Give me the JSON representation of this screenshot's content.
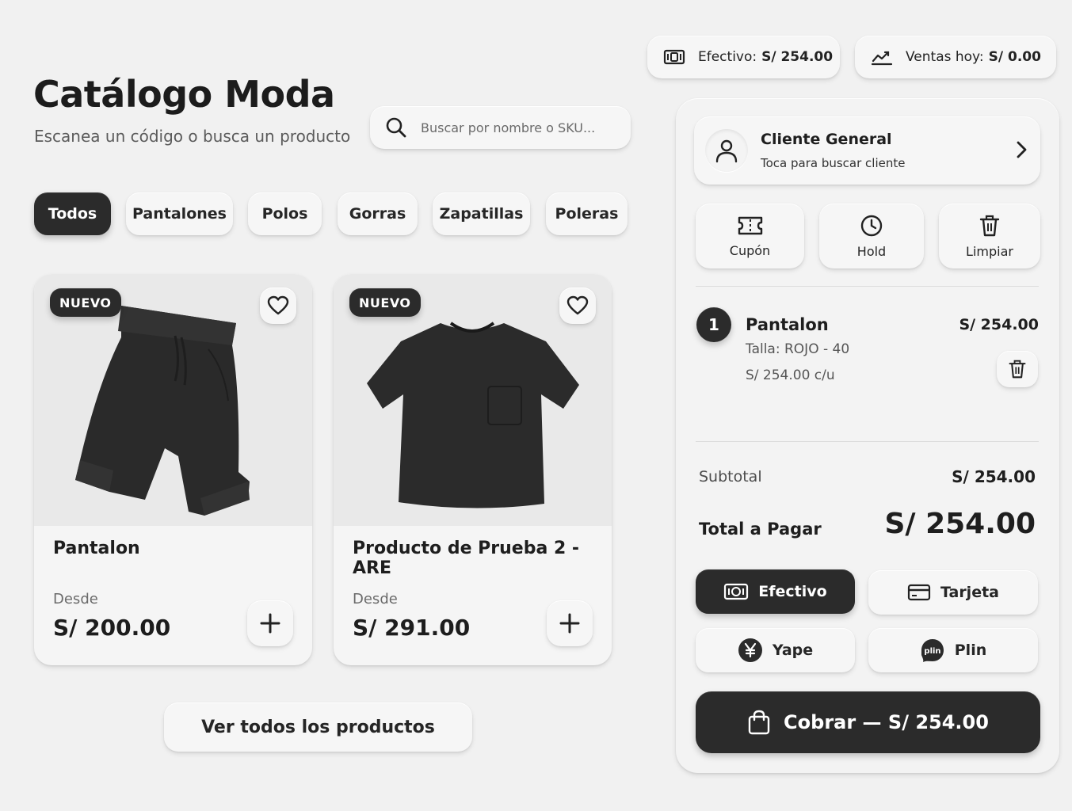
{
  "stats": {
    "cash_label": "Efectivo:",
    "cash_value": "S/ 254.00",
    "sales_label": "Ventas hoy:",
    "sales_value": "S/ 0.00"
  },
  "header": {
    "title": "Catálogo Moda",
    "subtitle": "Escanea un código o busca un producto"
  },
  "search": {
    "placeholder": "Buscar por nombre o SKU..."
  },
  "categories": [
    {
      "label": "Todos",
      "active": true
    },
    {
      "label": "Pantalones",
      "active": false
    },
    {
      "label": "Polos",
      "active": false
    },
    {
      "label": "Gorras",
      "active": false
    },
    {
      "label": "Zapatillas",
      "active": false
    },
    {
      "label": "Poleras",
      "active": false
    }
  ],
  "products": [
    {
      "badge": "NUEVO",
      "name": "Pantalon",
      "from_label": "Desde",
      "price": "S/ 200.00",
      "image": "black-shorts"
    },
    {
      "badge": "NUEVO",
      "name": "Producto de Prueba 2 - ARE",
      "from_label": "Desde",
      "price": "S/ 291.00",
      "image": "black-tshirt"
    }
  ],
  "view_all_label": "Ver todos los productos",
  "client": {
    "name": "Cliente General",
    "hint": "Toca para buscar cliente"
  },
  "actions": [
    {
      "label": "Cupón",
      "icon": "coupon-icon"
    },
    {
      "label": "Hold",
      "icon": "clock-icon"
    },
    {
      "label": "Limpiar",
      "icon": "trash-icon"
    }
  ],
  "cart": {
    "items": [
      {
        "qty": "1",
        "name": "Pantalon",
        "variant": "Talla: ROJO - 40",
        "unit_price": "S/ 254.00 c/u",
        "total": "S/ 254.00"
      }
    ],
    "subtotal_label": "Subtotal",
    "subtotal_value": "S/ 254.00",
    "total_label": "Total a Pagar",
    "total_value": "S/ 254.00"
  },
  "payment_methods": [
    {
      "label": "Efectivo",
      "icon": "cash-icon",
      "active": true
    },
    {
      "label": "Tarjeta",
      "icon": "card-icon",
      "active": false
    },
    {
      "label": "Yape",
      "icon": "yape-icon",
      "active": false
    },
    {
      "label": "Plin",
      "icon": "plin-icon",
      "active": false
    }
  ],
  "checkout_label": "Cobrar — S/ 254.00",
  "colors": {
    "background": "#f1f1f1",
    "dark": "#2b2b2b",
    "surface": "#f6f6f6"
  }
}
